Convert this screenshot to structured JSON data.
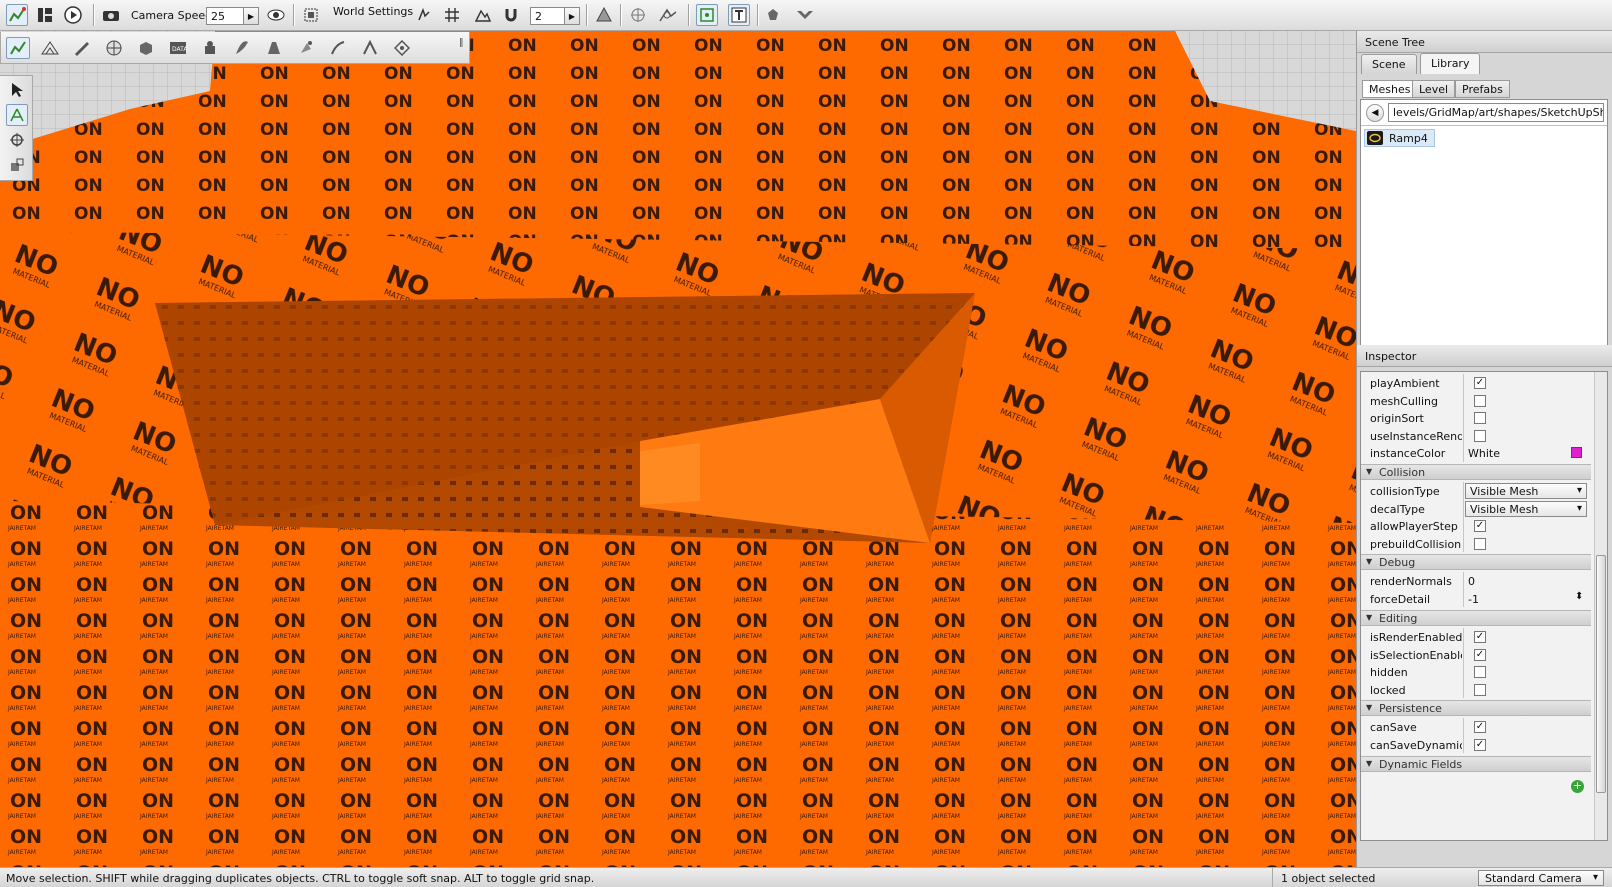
{
  "toolbar": {
    "camera_speed_label": "Camera Speed",
    "camera_speed_value": "25",
    "world_settings_label": "World Settings",
    "grid_size_value": "2"
  },
  "viewport": {
    "texture_text": "NO",
    "texture_subtext": "MATERIAL"
  },
  "scene_tree": {
    "title": "Scene Tree",
    "tabs": [
      {
        "label": "Scene",
        "active": false
      },
      {
        "label": "Library",
        "active": true
      }
    ],
    "subtabs": [
      {
        "label": "Meshes",
        "active": true
      },
      {
        "label": "Level",
        "active": false
      },
      {
        "label": "Prefabs",
        "active": false
      }
    ],
    "path": "levels/GridMap/art/shapes/SketchUpShapes",
    "items": [
      {
        "label": "Ramp4",
        "icon": "mesh-icon"
      }
    ]
  },
  "inspector": {
    "title": "Inspector",
    "rows_top": [
      {
        "label": "playAmbient",
        "type": "checkbox",
        "checked": true
      },
      {
        "label": "meshCulling",
        "type": "checkbox",
        "checked": false
      },
      {
        "label": "originSort",
        "type": "checkbox",
        "checked": false
      },
      {
        "label": "useInstanceRend...",
        "type": "checkbox",
        "checked": false
      },
      {
        "label": "instanceColor",
        "type": "color",
        "value": "White",
        "color": "#e020d0"
      }
    ],
    "collision": {
      "title": "Collision",
      "collision_type_label": "collisionType",
      "collision_type_value": "Visible Mesh",
      "decal_type_label": "decalType",
      "decal_type_value": "Visible Mesh",
      "allow_player_step_label": "allowPlayerStep",
      "prebuild_label": "prebuildCollisionD..."
    },
    "debug": {
      "title": "Debug",
      "render_normals_label": "renderNormals",
      "render_normals_value": "0",
      "force_detail_label": "forceDetail",
      "force_detail_value": "-1"
    },
    "editing": {
      "title": "Editing",
      "rows": [
        {
          "label": "isRenderEnabled",
          "checked": true
        },
        {
          "label": "isSelectionEnabled",
          "checked": true
        },
        {
          "label": "hidden",
          "checked": false
        },
        {
          "label": "locked",
          "checked": false
        }
      ]
    },
    "persistence": {
      "title": "Persistence",
      "rows": [
        {
          "label": "canSave",
          "checked": true
        },
        {
          "label": "canSaveDynamic...",
          "checked": true
        }
      ]
    },
    "dynamic_fields": {
      "title": "Dynamic Fields"
    }
  },
  "status": {
    "message": "Move selection.  SHIFT while dragging duplicates objects.  CTRL to toggle soft snap.  ALT to toggle grid snap.",
    "selection": "1 object selected",
    "camera": "Standard Camera"
  },
  "colors": {
    "accent": "#ff6a00",
    "selection": "#dbe9f6",
    "swatch": "#e020d0"
  }
}
